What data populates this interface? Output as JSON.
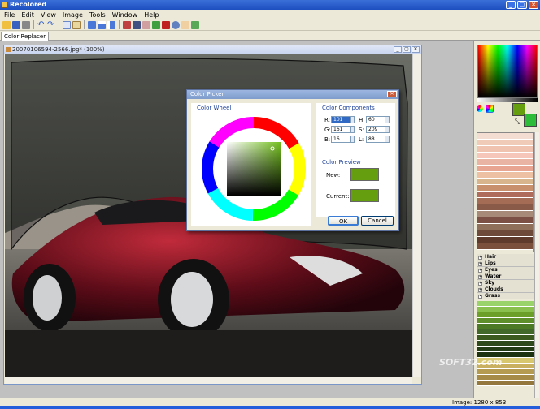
{
  "app": {
    "title": "Recolored"
  },
  "window_buttons": [
    "_",
    "▢",
    "✕"
  ],
  "menu": [
    {
      "label": "File"
    },
    {
      "label": "Edit"
    },
    {
      "label": "View"
    },
    {
      "label": "Image"
    },
    {
      "label": "Tools"
    },
    {
      "label": "Window"
    },
    {
      "label": "Help"
    }
  ],
  "toolbar_icons": [
    "open-icon",
    "save-icon",
    "print-icon",
    "undo-icon",
    "redo-icon",
    "copy-icon",
    "paste-icon",
    "view-single-icon",
    "view-split-h-icon",
    "view-split-v-icon",
    "brush-icon",
    "pen-icon",
    "eraser-icon",
    "eyedropper-icon",
    "color-fill-icon",
    "zoom-icon",
    "hand-icon",
    "crop-icon"
  ],
  "tab": {
    "label": "Color Replacer"
  },
  "image_window": {
    "title": "20070106594-2566.jpg* (100%)",
    "buttons": [
      "_",
      "▢",
      "✕"
    ]
  },
  "dialog": {
    "title": "Color Picker",
    "close": "✕",
    "wheel_label": "Color Wheel",
    "components_label": "Color Components",
    "fields": [
      {
        "label": "R:",
        "value": "101"
      },
      {
        "label": "H:",
        "value": "60"
      },
      {
        "label": "G:",
        "value": "161"
      },
      {
        "label": "S:",
        "value": "209"
      },
      {
        "label": "B:",
        "value": "16"
      },
      {
        "label": "L:",
        "value": "88"
      }
    ],
    "preview_label": "Color Preview",
    "new_label": "New:",
    "current_label": "Current:",
    "new_color": "#659f10",
    "current_color": "#659f10",
    "ok": "OK",
    "cancel": "Cancel"
  },
  "palette": {
    "primary_color": "#659f10",
    "secondary_color": "#2dbb3a",
    "skin_swatches": [
      "#f3dcd2",
      "#f0ccb8",
      "#efc3b0",
      "#f7c6ba",
      "#eab4a4",
      "#e8a592",
      "#edc0a4",
      "#d8b58c",
      "#c9906e",
      "#b06c5a",
      "#a56c55",
      "#8a5a48",
      "#a88a78",
      "#7c5044",
      "#8f6f5a",
      "#6e4a3a",
      "#5d3a2c",
      "#7a4f3b"
    ],
    "categories": [
      {
        "name": "Hair",
        "sign": "+"
      },
      {
        "name": "Lips",
        "sign": "+"
      },
      {
        "name": "Eyes",
        "sign": "+"
      },
      {
        "name": "Water",
        "sign": "+"
      },
      {
        "name": "Sky",
        "sign": "+"
      },
      {
        "name": "Clouds",
        "sign": "+"
      },
      {
        "name": "Grass",
        "sign": "-"
      }
    ],
    "grass_swatches": [
      "#9bd36b",
      "#8ac04e",
      "#6b9f2a",
      "#5f8f2a",
      "#4d7a24",
      "#42682a",
      "#3a5a1f",
      "#2f4a1a",
      "#233c14",
      "#1d3310",
      "#d7c870",
      "#c9b060",
      "#b59a52",
      "#a68a48",
      "#94773c"
    ]
  },
  "status": {
    "image_size": "Image: 1280 x 853"
  },
  "watermark": "SOFT32.com"
}
